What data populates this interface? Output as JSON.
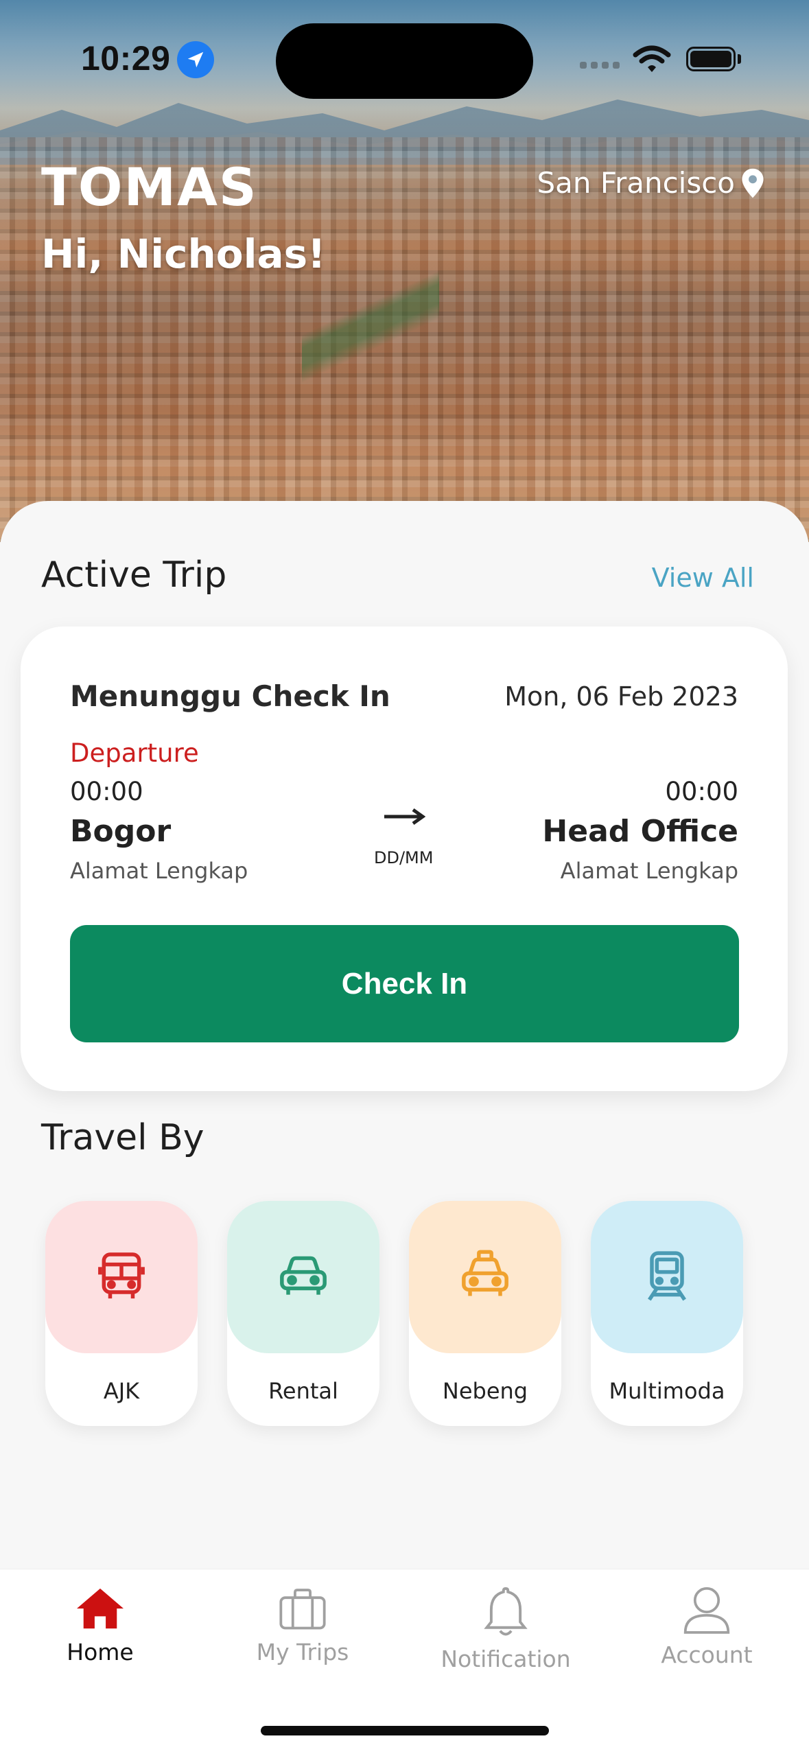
{
  "status_bar": {
    "time": "10:29"
  },
  "header": {
    "logo": "TOMAS",
    "greeting": "Hi, Nicholas!",
    "location": "San Francisco"
  },
  "active_trip": {
    "section_title": "Active Trip",
    "view_all": "View All",
    "status": "Menunggu Check In",
    "date": "Mon, 06 Feb 2023",
    "departure_label": "Departure",
    "from": {
      "time": "00:00",
      "city": "Bogor",
      "address": "Alamat Lengkap"
    },
    "to": {
      "time": "00:00",
      "city": "Head Office",
      "address": "Alamat Lengkap"
    },
    "date_placeholder": "DD/MM",
    "checkin_button": "Check In"
  },
  "travel_by": {
    "section_title": "Travel By",
    "modes": [
      {
        "label": "AJK",
        "icon": "bus-icon",
        "bg": "#fde0e1",
        "color": "#d62b2b"
      },
      {
        "label": "Rental",
        "icon": "car-icon",
        "bg": "#d9f2eb",
        "color": "#2a9a75"
      },
      {
        "label": "Nebeng",
        "icon": "taxi-icon",
        "bg": "#fee8cf",
        "color": "#f0a12e"
      },
      {
        "label": "Multimoda",
        "icon": "train-icon",
        "bg": "#cfedf7",
        "color": "#4a9bb4"
      }
    ]
  },
  "tabbar": {
    "tabs": [
      {
        "label": "Home",
        "icon": "home-icon",
        "active": true
      },
      {
        "label": "My Trips",
        "icon": "briefcase-icon",
        "active": false
      },
      {
        "label": "Notification",
        "icon": "bell-icon",
        "active": false
      },
      {
        "label": "Account",
        "icon": "user-icon",
        "active": false
      }
    ]
  },
  "colors": {
    "primary_green": "#0c8a5f",
    "accent_red": "#cc1f1f",
    "link_blue": "#4aa4c4",
    "tab_active": "#cc1111",
    "tab_inactive": "#a0a0a0"
  }
}
